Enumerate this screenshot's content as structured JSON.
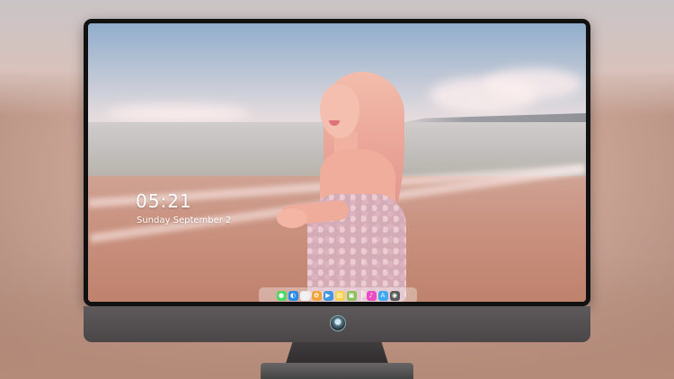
{
  "lock_screen": {
    "time": "05:21",
    "date": "Sunday September 2"
  },
  "dock": {
    "apps": [
      {
        "name": "messages-icon",
        "glyph": "●",
        "color": "#4cd964"
      },
      {
        "name": "finder-icon",
        "glyph": "◐",
        "color": "#2a8bea"
      },
      {
        "name": "clock-icon",
        "glyph": "◷",
        "color": "#eeeeee"
      },
      {
        "name": "photos-icon",
        "glyph": "✿",
        "color": "#f2a33a"
      },
      {
        "name": "video-icon",
        "glyph": "▶",
        "color": "#3d98e0"
      },
      {
        "name": "notes-icon",
        "glyph": "▤",
        "color": "#f6d24a"
      },
      {
        "name": "preview-icon",
        "glyph": "▣",
        "color": "#8cbf5a"
      },
      {
        "name": "itunes-icon",
        "glyph": "♪",
        "color": "#e94cc2"
      },
      {
        "name": "app-store-icon",
        "glyph": "A",
        "color": "#3ea8f2"
      },
      {
        "name": "camera-icon",
        "glyph": "◉",
        "color": "#5a5a5a"
      }
    ]
  },
  "colors": {
    "bezel": "#111111",
    "chin": "#555053",
    "dock_background": "rgba(255,255,255,0.35)"
  }
}
